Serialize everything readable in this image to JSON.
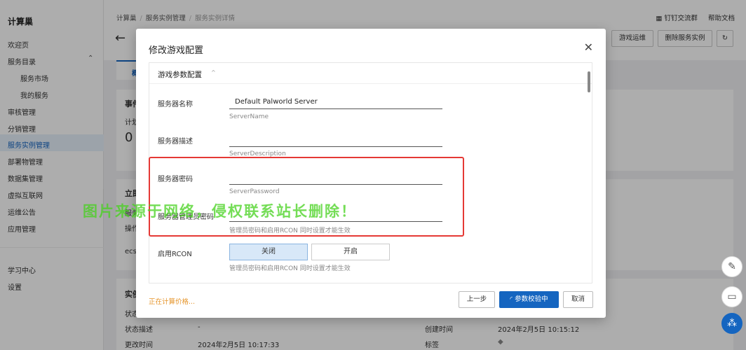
{
  "sidebar": {
    "title": "计算巢",
    "items": [
      {
        "label": "欢迎页"
      },
      {
        "label": "服务目录"
      },
      {
        "label": "服务市场"
      },
      {
        "label": "我的服务"
      },
      {
        "label": "审核管理"
      },
      {
        "label": "分销管理"
      },
      {
        "label": "服务实例管理"
      },
      {
        "label": "部署物管理"
      },
      {
        "label": "数据集管理"
      },
      {
        "label": "虚拟互联网"
      },
      {
        "label": "运维公告"
      },
      {
        "label": "应用管理"
      },
      {
        "label": "学习中心"
      },
      {
        "label": "设置"
      }
    ],
    "collapse_glyph": "<"
  },
  "header": {
    "breadcrumb": [
      "计算巢",
      "服务实例管理",
      "服务实例详情"
    ],
    "links": [
      "钉钉交流群",
      "帮助文档"
    ],
    "buttons": {
      "ops": "游戏运维",
      "delete": "删除服务实例"
    },
    "tab_partial": "概"
  },
  "background": {
    "events_title": "事件",
    "plan_label": "计划",
    "plan_value": "0",
    "immediate_title": "立即",
    "service_label": "服务",
    "ops_label": "操作",
    "ecs_label": "ecs",
    "instance_title": "实例",
    "status_label": "状态",
    "status_desc_label": "状态描述",
    "status_desc_value": "-",
    "update_time_label": "更改时间",
    "update_time_value": "2024年2月5日 10:17:33",
    "create_time_label": "创建时间",
    "create_time_value": "2024年2月5日 10:15:12",
    "tag_label": "标签"
  },
  "modal": {
    "title": "修改游戏配置",
    "section_title": "游戏参数配置",
    "fields": [
      {
        "label": "服务器名称",
        "value": "Default Palworld Server",
        "help": "ServerName"
      },
      {
        "label": "服务器描述",
        "value": "",
        "help": "ServerDescription"
      },
      {
        "label": "服务器密码",
        "value": "",
        "help": "ServerPassword"
      },
      {
        "label": "服务器管理员密码",
        "value": "",
        "help": "管理员密码和启用RCON 同时设置才能生效"
      }
    ],
    "rcon": {
      "label": "启用RCON",
      "options": [
        "关闭",
        "开启"
      ],
      "selected": "关闭",
      "help": "管理员密码和启用RCON 同时设置才能生效"
    },
    "price_status": "正在计算价格...",
    "buttons": {
      "prev": "上一步",
      "validate": "参数校验中",
      "cancel": "取消"
    }
  },
  "watermark": "图片来源于网络，侵权联系站长删除！",
  "colors": {
    "primary": "#1565c0",
    "highlight": "#e53935",
    "watermark": "#46d21e",
    "price": "#e6952b"
  }
}
